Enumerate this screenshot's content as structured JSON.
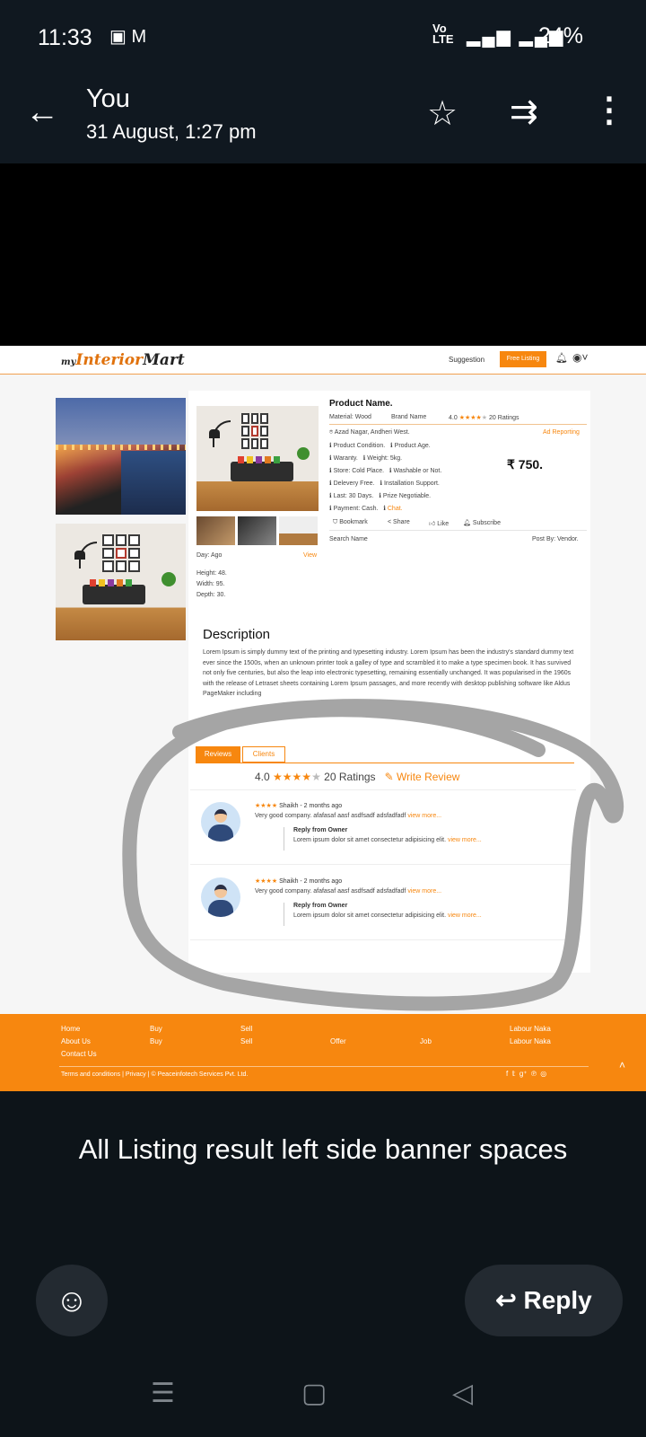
{
  "status_bar": {
    "time": "11:33",
    "network": "VoLTE 5G",
    "battery": "24%"
  },
  "header": {
    "sender": "You",
    "date": "31 August, 1:27 pm"
  },
  "screenshot": {
    "logo": {
      "prefix": "my",
      "main": "Interior",
      "suffix": "Mart"
    },
    "nav": {
      "suggestion": "Suggestion",
      "free_listing": "Free Listing"
    },
    "product": {
      "name": "Product Name.",
      "material": "Material: Wood",
      "brand": "Brand Name",
      "rating_value": "4.0",
      "ratings_count": "20 Ratings",
      "location": "Azad Nagar, Andheri West.",
      "ad_reporting": "Ad Reporting",
      "details": [
        [
          "Product Condition.",
          "Product Age."
        ],
        [
          "Waranty.",
          "Weight: 5kg."
        ],
        [
          "Store: Cold Place.",
          "Washable or Not."
        ],
        [
          "Delevery Free.",
          "Installation Support."
        ],
        [
          "Last: 30 Days.",
          "Prize Negotiable."
        ],
        [
          "Payment: Cash.",
          "Chat."
        ]
      ],
      "price": "₹ 750.",
      "actions": [
        "Bookmark",
        "Share",
        "Like",
        "Subscribe"
      ],
      "day": "Day: Ago",
      "view": "View",
      "search_name": "Search Name",
      "post_by": "Post By: Vendor.",
      "dimensions": [
        "Height: 48.",
        "Width: 95.",
        "Depth: 30."
      ]
    },
    "description": {
      "title": "Description",
      "text": "Lorem Ipsum is simply dummy text of the printing and typesetting industry. Lorem Ipsum has been the industry's standard dummy text ever since the 1500s, when an unknown printer took a galley of type and scrambled it to make a type specimen book. It has survived not only five centuries, but also the leap into electronic typesetting, remaining essentially unchanged. It was popularised in the 1960s with the release of Letraset sheets containing Lorem Ipsum passages, and more recently with desktop publishing software like Aldus PageMaker including"
    },
    "reviews": {
      "tabs": [
        "Reviews",
        "Clients"
      ],
      "rating_value": "4.0",
      "ratings_count": "20 Ratings",
      "write_review": "Write Review",
      "items": [
        {
          "author": "Shaikh - 2 months ago",
          "text": "Very good company. afafasaf aasf asdfsadf adsfadfadf",
          "view_more": "view more...",
          "reply_title": "Reply from Owner",
          "reply_text": "Lorem ipsum dolor sit amet consectetur adipisicing elit.",
          "reply_more": "view more..."
        },
        {
          "author": "Shaikh - 2 months ago",
          "text": "Very good company. afafasaf aasf asdfsadf adsfadfadf",
          "view_more": "view more...",
          "reply_title": "Reply from Owner",
          "reply_text": "Lorem ipsum dolor sit amet consectetur adipisicing elit.",
          "reply_more": "view more..."
        }
      ]
    },
    "footer": {
      "col1": [
        "Home",
        "About Us",
        "Contact Us"
      ],
      "col2": [
        "Buy",
        "Buy"
      ],
      "col3": [
        "Sell",
        "Sell"
      ],
      "col4": [
        "Offer"
      ],
      "col5": [
        "Job"
      ],
      "col6": [
        "Labour Naka",
        "Labour Naka"
      ],
      "bottom": "Terms and conditions  |  Privacy  |  © Peaceinfotech Services Pvt. Ltd."
    }
  },
  "caption": "All Listing result left side banner spaces",
  "reply_button": "Reply",
  "colors": {
    "accent": "#f7870f",
    "bg": "#0d1419",
    "button_bg": "#232a31"
  }
}
